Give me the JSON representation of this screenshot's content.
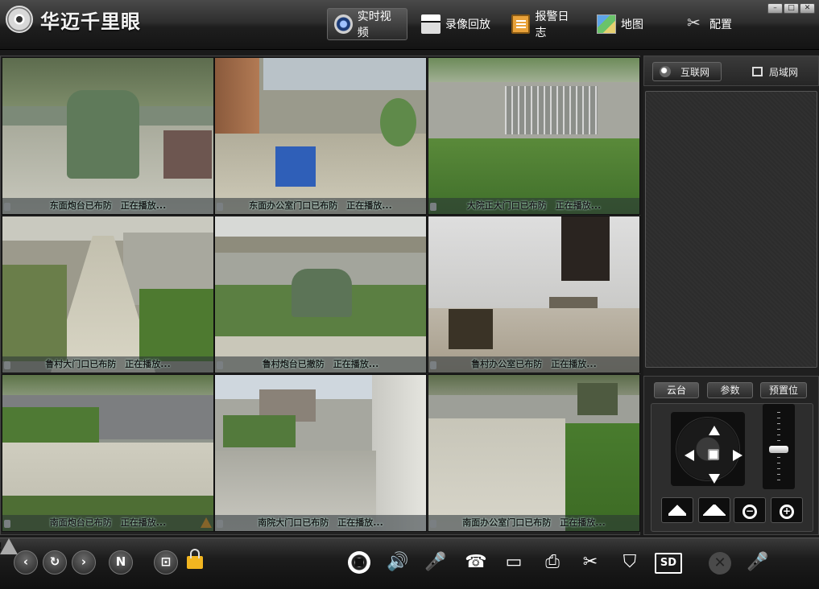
{
  "app": {
    "title": "华迈千里眼"
  },
  "nav": {
    "items": [
      {
        "label": "实时视频",
        "icon": "camera-icon",
        "active": true
      },
      {
        "label": "录像回放",
        "icon": "clapper-icon"
      },
      {
        "label": "报警日志",
        "icon": "clipboard-icon"
      },
      {
        "label": "地图",
        "icon": "map-icon"
      },
      {
        "label": "配置",
        "icon": "tools-icon"
      }
    ]
  },
  "window_controls": {
    "min": "–",
    "max": "□",
    "close": "✕"
  },
  "cameras": [
    {
      "caption": "东面炮台已布防　正在播放..."
    },
    {
      "caption": "东面办公室门口已布防　正在播放..."
    },
    {
      "caption": "大院正大门口已布防　正在播放..."
    },
    {
      "caption": "鲁村大门口已布防　正在播放..."
    },
    {
      "caption": "鲁村炮台已撤防　正在播放..."
    },
    {
      "caption": "鲁村办公室已布防　正在播放..."
    },
    {
      "caption": "南面炮台已布防　正在播放...",
      "warning": true
    },
    {
      "caption": "南院大门口已布防　正在播放..."
    },
    {
      "caption": "南面办公室门口已布防　正在播放..."
    }
  ],
  "network_tabs": {
    "internet": "互联网",
    "lan": "局域网"
  },
  "ptz": {
    "tabs": {
      "ptz": "云台",
      "params": "参数",
      "preset": "预置位"
    },
    "zoom_level": 0.45
  },
  "toolbar": {
    "prev": "‹",
    "refresh": "↻",
    "next": "›",
    "n": "N",
    "fit": "⊡",
    "volume": "🔊",
    "mic": "🎤",
    "talk": "☎",
    "record": "▭",
    "snapshot": "⎙",
    "cut": "✂",
    "shield": "⛉",
    "sd": "SD",
    "disabled_x": "✕",
    "disabled_mic": "🎤"
  },
  "colors": {
    "accent": "#f7a21b",
    "caption_bg": "#2a3237"
  }
}
